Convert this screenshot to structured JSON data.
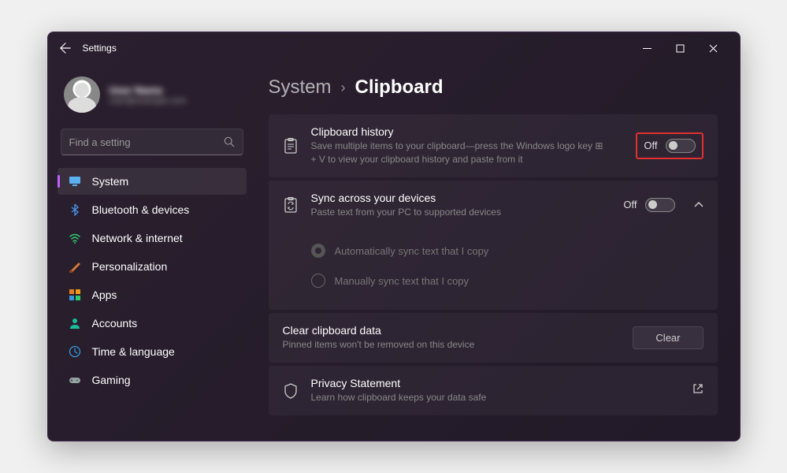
{
  "window": {
    "title": "Settings"
  },
  "profile": {
    "name": "User Name",
    "email": "user@example.com"
  },
  "search": {
    "placeholder": "Find a setting"
  },
  "nav": {
    "items": [
      {
        "label": "System"
      },
      {
        "label": "Bluetooth & devices"
      },
      {
        "label": "Network & internet"
      },
      {
        "label": "Personalization"
      },
      {
        "label": "Apps"
      },
      {
        "label": "Accounts"
      },
      {
        "label": "Time & language"
      },
      {
        "label": "Gaming"
      }
    ]
  },
  "breadcrumb": {
    "parent": "System",
    "current": "Clipboard"
  },
  "cards": {
    "history": {
      "title": "Clipboard history",
      "desc": "Save multiple items to your clipboard—press the Windows logo key ⊞ + V to view your clipboard history and paste from it",
      "state_label": "Off"
    },
    "sync": {
      "title": "Sync across your devices",
      "desc": "Paste text from your PC to supported devices",
      "state_label": "Off",
      "options": {
        "auto": "Automatically sync text that I copy",
        "manual": "Manually sync text that I copy"
      }
    },
    "clear": {
      "title": "Clear clipboard data",
      "desc": "Pinned items won't be removed on this device",
      "button": "Clear"
    },
    "privacy": {
      "title": "Privacy Statement",
      "desc": "Learn how clipboard keeps your data safe"
    }
  }
}
